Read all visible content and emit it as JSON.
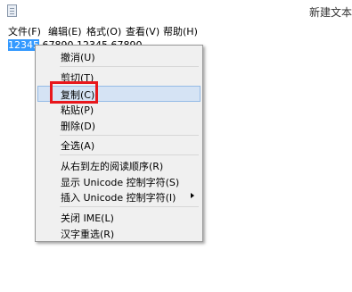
{
  "window": {
    "title": "新建文本"
  },
  "menubar": {
    "file": "文件(F)",
    "edit": "编辑(E)",
    "format": "格式(O)",
    "view": "查看(V)",
    "help": "帮助(H)"
  },
  "editor": {
    "selected_text": "12345",
    "rest_text": " 67890  12345  67890"
  },
  "context_menu": {
    "undo": "撤消(U)",
    "cut": "剪切(T)",
    "copy": "复制(C)",
    "paste": "粘贴(P)",
    "delete": "删除(D)",
    "select_all": "全选(A)",
    "rtl": "从右到左的阅读顺序(R)",
    "show_unicode": "显示 Unicode 控制字符(S)",
    "insert_unicode": "插入 Unicode 控制字符(I)",
    "close_ime": "关闭 IME(L)",
    "reconversion": "汉字重选(R)"
  },
  "colors": {
    "highlight": "#d5e3f4",
    "annotation": "#e8171c",
    "selection": "#3399ff"
  }
}
